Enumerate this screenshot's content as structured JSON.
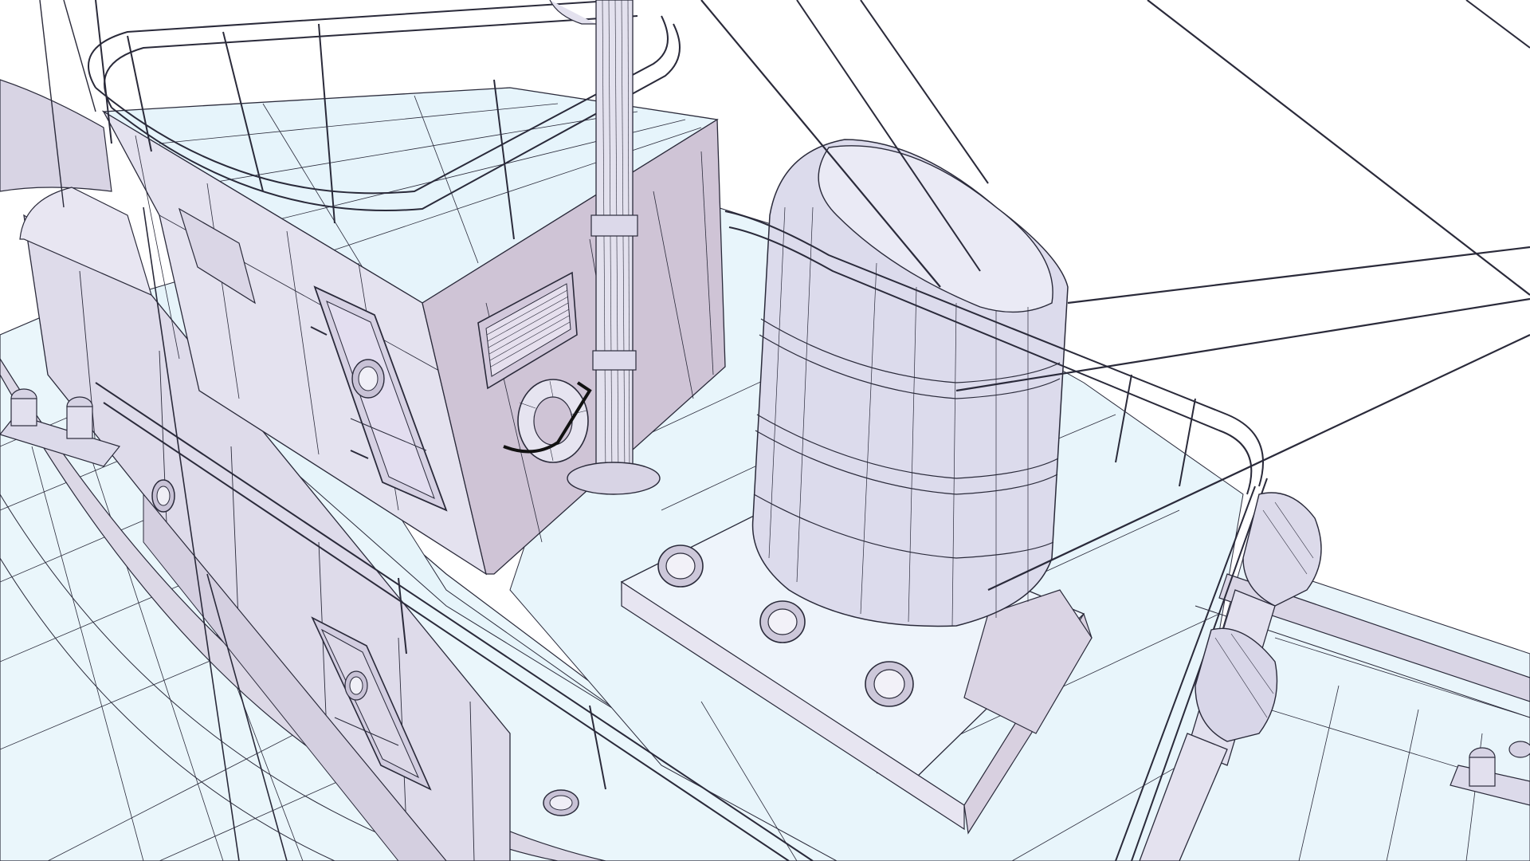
{
  "scene": {
    "subject": "boat-deck-wireframe-render",
    "palette": {
      "deck": "#eaf6fb",
      "deck_shadow": "#d9eef7",
      "wall_light": "#e8e6f2",
      "wall_mid": "#d6d0e2",
      "wall_dark": "#c9bfd3",
      "funnel_body": "#dcdced",
      "funnel_top": "#e9e9f4",
      "wire": "#2a2a3a",
      "background": "#ffffff"
    },
    "icons": [
      "life-ring-icon",
      "porthole-icon",
      "hatch-door-icon",
      "vent-grille-icon",
      "bollard-icon"
    ]
  }
}
